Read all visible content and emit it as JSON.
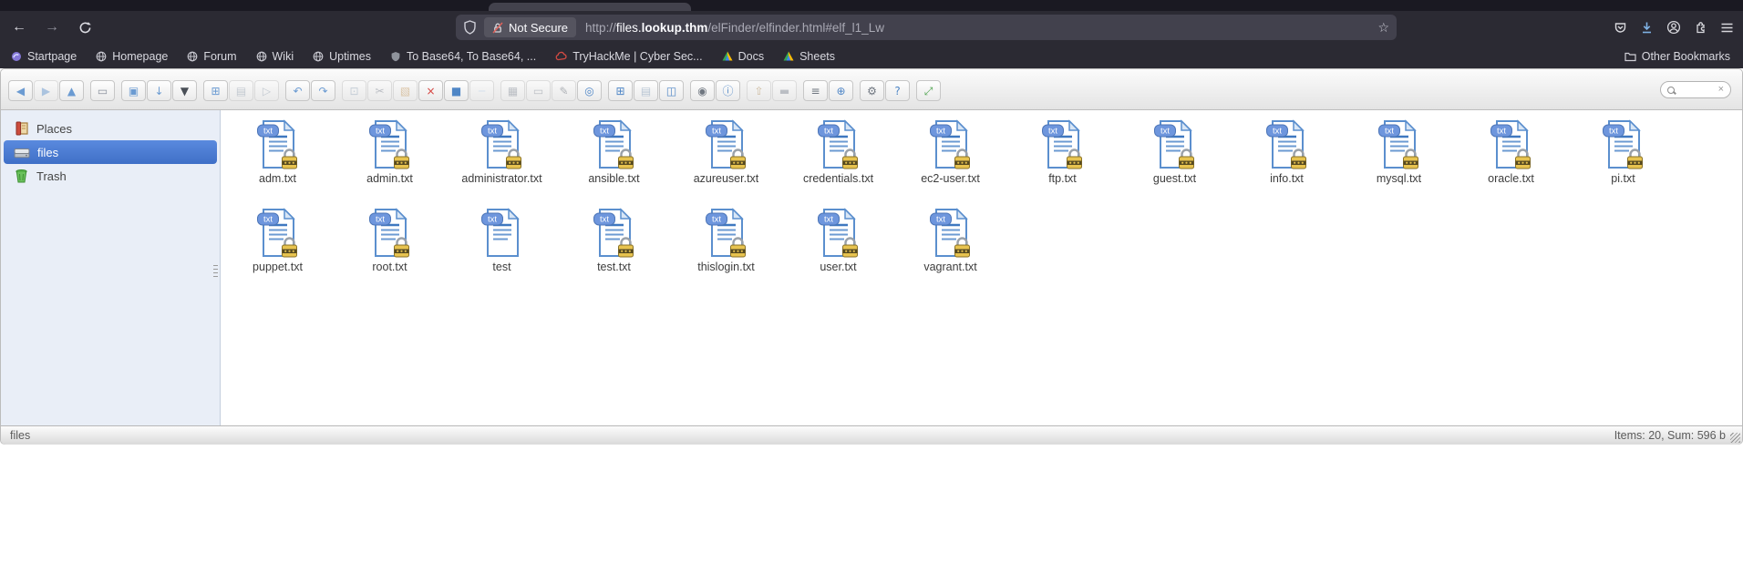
{
  "browser": {
    "navbar": {
      "back_glyph": "←",
      "forward_glyph": "→",
      "security_chip": "Not Secure",
      "url": {
        "scheme": "http://",
        "subdomain": "files.",
        "domain": "lookup.thm",
        "path": "/elFinder/elfinder.html#elf_l1_Lw"
      },
      "star_glyph": "☆"
    },
    "bookmarks": [
      {
        "label": "Startpage",
        "icon": "startpage-icon"
      },
      {
        "label": "Homepage",
        "icon": "globe-icon"
      },
      {
        "label": "Forum",
        "icon": "globe-icon"
      },
      {
        "label": "Wiki",
        "icon": "globe-icon"
      },
      {
        "label": "Uptimes",
        "icon": "globe-icon"
      },
      {
        "label": "To Base64, To Base64, ...",
        "icon": "shield-icon"
      },
      {
        "label": "TryHackMe | Cyber Sec...",
        "icon": "cloud-icon"
      },
      {
        "label": "Docs",
        "icon": "drive-icon"
      },
      {
        "label": "Sheets",
        "icon": "drive-icon"
      }
    ],
    "other_bookmarks": {
      "label": "Other Bookmarks"
    }
  },
  "elfinder": {
    "toolbar": {
      "groups": [
        {
          "buttons": [
            {
              "name": "back",
              "glyph": "◀",
              "color": "#6b9bd2",
              "disabled": false
            },
            {
              "name": "forward",
              "glyph": "▶",
              "color": "#6b9bd2",
              "disabled": true
            },
            {
              "name": "up",
              "glyph": "▲",
              "color": "#6b9bd2",
              "disabled": false
            }
          ]
        },
        {
          "buttons": [
            {
              "name": "netmount",
              "glyph": "▭",
              "color": "#8a919c",
              "disabled": false
            }
          ]
        },
        {
          "buttons": [
            {
              "name": "open",
              "glyph": "▣",
              "color": "#6b9bd2",
              "disabled": false
            },
            {
              "name": "download",
              "glyph": "↓",
              "color": "#6b9bd2",
              "disabled": false
            },
            {
              "name": "save",
              "glyph": "▼",
              "color": "#4a4f57",
              "disabled": false
            }
          ]
        },
        {
          "buttons": [
            {
              "name": "mkdir",
              "glyph": "⊞",
              "color": "#6b9bd2",
              "disabled": false
            },
            {
              "name": "mkfile",
              "glyph": "▤",
              "color": "#9aa7b5",
              "disabled": true
            },
            {
              "name": "upload",
              "glyph": "▷",
              "color": "#9aa7b5",
              "disabled": true
            }
          ]
        },
        {
          "buttons": [
            {
              "name": "undo",
              "glyph": "↶",
              "color": "#6b9bd2",
              "disabled": false
            },
            {
              "name": "redo",
              "glyph": "↷",
              "color": "#6b9bd2",
              "disabled": false
            }
          ]
        },
        {
          "buttons": [
            {
              "name": "copy",
              "glyph": "⊡",
              "color": "#9fb0c2",
              "disabled": true
            },
            {
              "name": "cut",
              "glyph": "✂",
              "color": "#8a919c",
              "disabled": true
            },
            {
              "name": "paste",
              "glyph": "▧",
              "color": "#c79a5e",
              "disabled": true
            },
            {
              "name": "delete",
              "glyph": "×",
              "color": "#d64541",
              "disabled": false
            },
            {
              "name": "empty",
              "glyph": "■",
              "color": "#4f86c6",
              "disabled": false
            },
            {
              "name": "resize",
              "glyph": "─",
              "color": "#bcd2ea",
              "disabled": true
            }
          ]
        },
        {
          "buttons": [
            {
              "name": "duplicate",
              "glyph": "▦",
              "color": "#8a919c",
              "disabled": true
            },
            {
              "name": "rename",
              "glyph": "▭",
              "color": "#8a919c",
              "disabled": true
            },
            {
              "name": "edit",
              "glyph": "✎",
              "color": "#6f7680",
              "disabled": true
            },
            {
              "name": "quicklook",
              "glyph": "◎",
              "color": "#4f86c6",
              "disabled": false
            }
          ]
        },
        {
          "buttons": [
            {
              "name": "view-icons",
              "glyph": "⊞",
              "color": "#4f86c6",
              "disabled": false
            },
            {
              "name": "view-list",
              "glyph": "▤",
              "color": "#b9c6d4",
              "disabled": false
            },
            {
              "name": "split",
              "glyph": "◫",
              "color": "#4f86c6",
              "disabled": false
            }
          ]
        },
        {
          "buttons": [
            {
              "name": "preview",
              "glyph": "◉",
              "color": "#6f7680",
              "disabled": false
            },
            {
              "name": "info",
              "glyph": "ⓘ",
              "color": "#4f86c6",
              "disabled": false
            }
          ]
        },
        {
          "buttons": [
            {
              "name": "extract",
              "glyph": "⇧",
              "color": "#b08d57",
              "disabled": true
            },
            {
              "name": "archive",
              "glyph": "▬",
              "color": "#8a919c",
              "disabled": true
            }
          ]
        },
        {
          "buttons": [
            {
              "name": "sort",
              "glyph": "≡",
              "color": "#6f7680",
              "disabled": false
            },
            {
              "name": "charset",
              "glyph": "⊕",
              "color": "#4f86c6",
              "disabled": false
            }
          ]
        },
        {
          "buttons": [
            {
              "name": "preference",
              "glyph": "⚙",
              "color": "#6f7680",
              "disabled": false
            },
            {
              "name": "help",
              "glyph": "?",
              "color": "#4f86c6",
              "disabled": false
            }
          ]
        },
        {
          "buttons": [
            {
              "name": "fullscreen",
              "glyph": "⤢",
              "color": "#4ea34e",
              "disabled": false
            }
          ]
        }
      ]
    },
    "sidebar": {
      "items": [
        {
          "label": "Places",
          "selected": false
        },
        {
          "label": "files",
          "selected": true
        },
        {
          "label": "Trash",
          "selected": false
        }
      ]
    },
    "files": [
      {
        "name": "adm.txt",
        "badge": "txt",
        "locked": true
      },
      {
        "name": "admin.txt",
        "badge": "txt",
        "locked": true
      },
      {
        "name": "administrator.txt",
        "badge": "txt",
        "locked": true
      },
      {
        "name": "ansible.txt",
        "badge": "txt",
        "locked": true
      },
      {
        "name": "azureuser.txt",
        "badge": "txt",
        "locked": true
      },
      {
        "name": "credentials.txt",
        "badge": "txt",
        "locked": true
      },
      {
        "name": "ec2-user.txt",
        "badge": "txt",
        "locked": true
      },
      {
        "name": "ftp.txt",
        "badge": "txt",
        "locked": true
      },
      {
        "name": "guest.txt",
        "badge": "txt",
        "locked": true
      },
      {
        "name": "info.txt",
        "badge": "txt",
        "locked": true
      },
      {
        "name": "mysql.txt",
        "badge": "txt",
        "locked": true
      },
      {
        "name": "oracle.txt",
        "badge": "txt",
        "locked": true
      },
      {
        "name": "pi.txt",
        "badge": "txt",
        "locked": true
      },
      {
        "name": "puppet.txt",
        "badge": "txt",
        "locked": true
      },
      {
        "name": "root.txt",
        "badge": "txt",
        "locked": true
      },
      {
        "name": "test",
        "badge": "txt",
        "locked": false
      },
      {
        "name": "test.txt",
        "badge": "txt",
        "locked": true
      },
      {
        "name": "thislogin.txt",
        "badge": "txt",
        "locked": true
      },
      {
        "name": "user.txt",
        "badge": "txt",
        "locked": true
      },
      {
        "name": "vagrant.txt",
        "badge": "txt",
        "locked": true
      }
    ],
    "statusbar": {
      "left": "files",
      "right": "Items: 20, Sum: 596 b"
    }
  }
}
